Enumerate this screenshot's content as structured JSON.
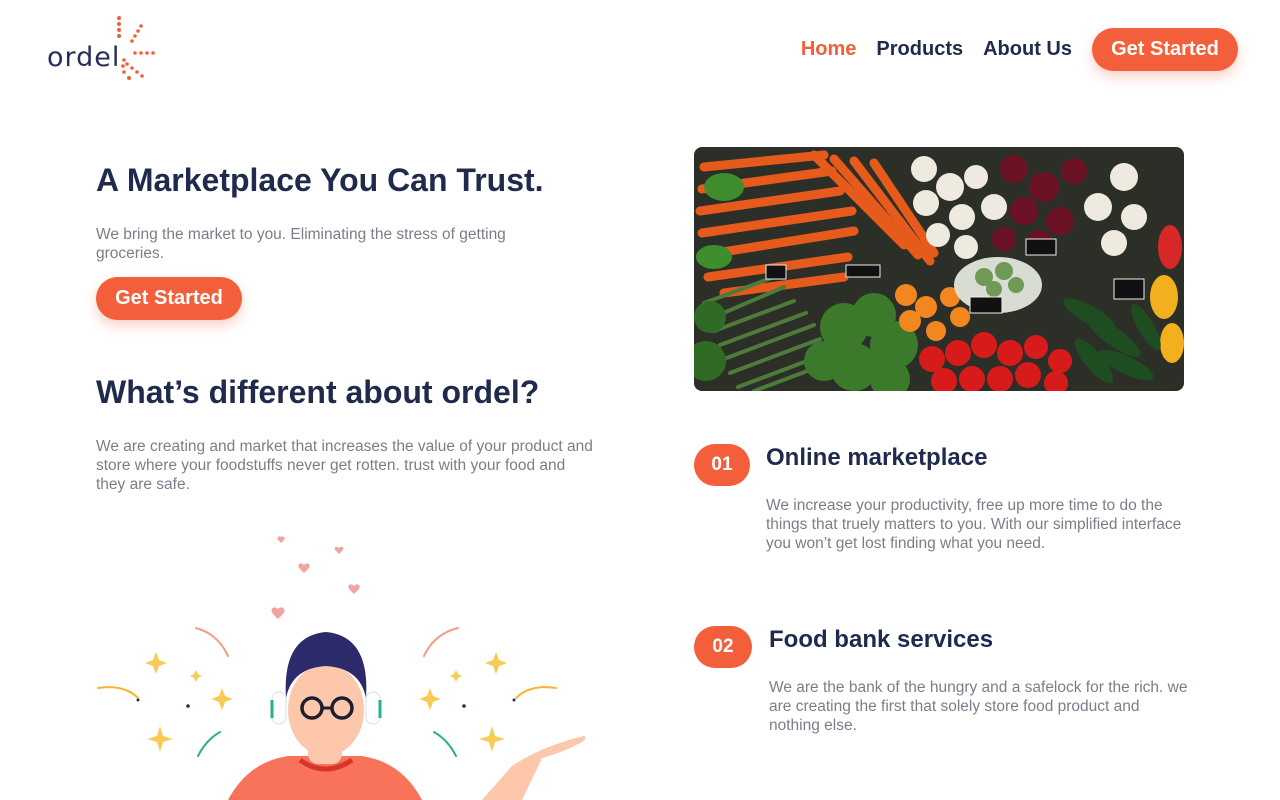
{
  "brand": {
    "name": "ordel",
    "accent": "#f35f3b",
    "navy": "#1f2a4d"
  },
  "nav": {
    "items": [
      {
        "label": "Home",
        "active": true
      },
      {
        "label": "Products",
        "active": false
      },
      {
        "label": "About Us",
        "active": false
      }
    ],
    "cta": "Get Started"
  },
  "hero": {
    "title": "A Marketplace You Can Trust.",
    "subtitle": "We bring the market to you. Eliminating the stress of getting groceries.",
    "cta": "Get Started",
    "image_icon": "vegetable-market-photo"
  },
  "different": {
    "title": "What’s different about ordel?",
    "text": "We are creating and market that increases the value of your product and store where your foodstuffs never get rotten. trust with your food and they are safe."
  },
  "features": [
    {
      "number": "01",
      "title": "Online marketplace",
      "text": "We increase your productivity, free up more time to do the things that truely matters to you. With our simplified interface you won’t get lost finding what you need."
    },
    {
      "number": "02",
      "title": "Food bank services",
      "text": "We are the bank of the hungry and a safelock for the rich. we are creating the first that solely store food product and nothing else."
    }
  ]
}
